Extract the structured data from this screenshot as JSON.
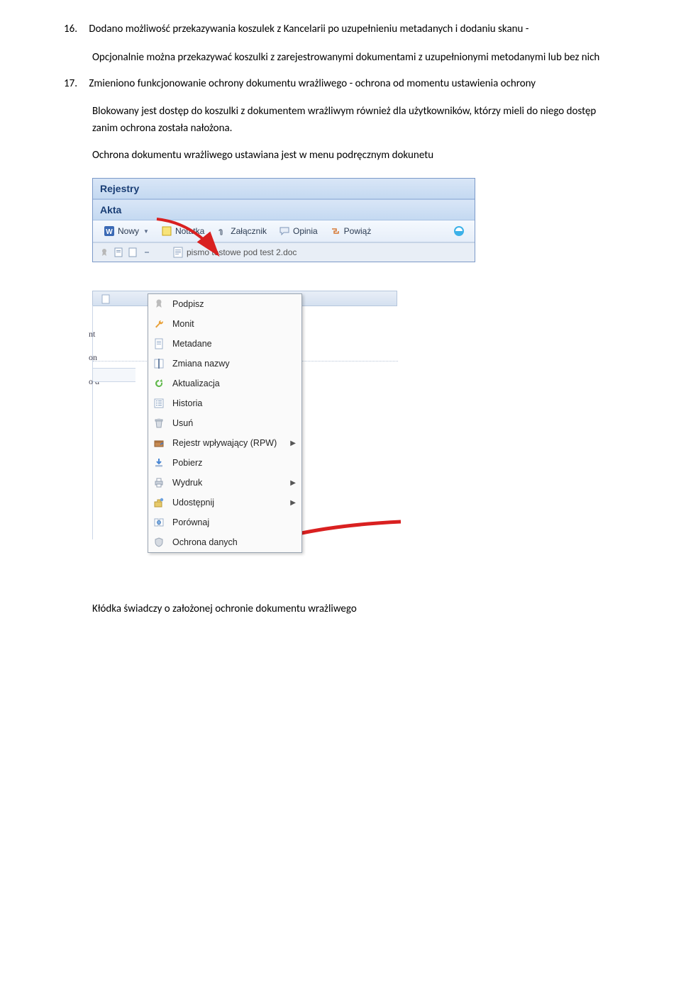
{
  "item16": {
    "num": "16.",
    "title": "Dodano możliwość przekazywania koszulek z Kancelarii po uzupełnieniu metadanych i dodaniu skanu -",
    "desc": "Opcjonalnie można przekazywać koszulki z zarejestrowanymi dokumentami z uzupełnionymi metodanymi lub bez nich"
  },
  "item17": {
    "num": "17.",
    "title": "Zmieniono funkcjonowanie ochrony dokumentu wrażliwego - ochrona od momentu ustawienia ochrony",
    "desc": "Blokowany jest dostęp do koszulki z dokumentem wrażliwym również dla użytkowników, którzy mieli do niego dostęp zanim ochrona została nałożona.",
    "desc2": "Ochrona dokumentu wrażliwego ustawiana jest w menu podręcznym dokunetu"
  },
  "panel1": {
    "header1": "Rejestry",
    "header2": "Akta",
    "toolbar": {
      "nowy": "Nowy",
      "notatka": "Notatka",
      "zalacznik": "Załącznik",
      "opinia": "Opinia",
      "powiaz": "Powiąż"
    },
    "doc_label": "pismo testowe pod test 2.doc"
  },
  "panel2": {
    "left_fragments": [
      "nt",
      "on",
      "o d"
    ]
  },
  "context_menu": {
    "items": [
      {
        "label": "Podpisz",
        "icon": "ribbon-icon",
        "submenu": false
      },
      {
        "label": "Monit",
        "icon": "wrench-icon",
        "submenu": false
      },
      {
        "label": "Metadane",
        "icon": "page-icon",
        "submenu": false
      },
      {
        "label": "Zmiana nazwy",
        "icon": "rename-icon",
        "submenu": false
      },
      {
        "label": "Aktualizacja",
        "icon": "refresh-icon",
        "submenu": false
      },
      {
        "label": "Historia",
        "icon": "list-icon",
        "submenu": false
      },
      {
        "label": "Usuń",
        "icon": "trash-icon",
        "submenu": false
      },
      {
        "label": "Rejestr wpływający (RPW)",
        "icon": "box-icon",
        "submenu": true
      },
      {
        "label": "Pobierz",
        "icon": "download-icon",
        "submenu": false
      },
      {
        "label": "Wydruk",
        "icon": "printer-icon",
        "submenu": true
      },
      {
        "label": "Udostępnij",
        "icon": "share-icon",
        "submenu": true
      },
      {
        "label": "Porównaj",
        "icon": "compare-icon",
        "submenu": false
      },
      {
        "label": "Ochrona danych",
        "icon": "shield-icon",
        "submenu": false
      }
    ]
  },
  "footer": "Kłódka świadczy o założonej ochronie dokumentu wrażliwego"
}
